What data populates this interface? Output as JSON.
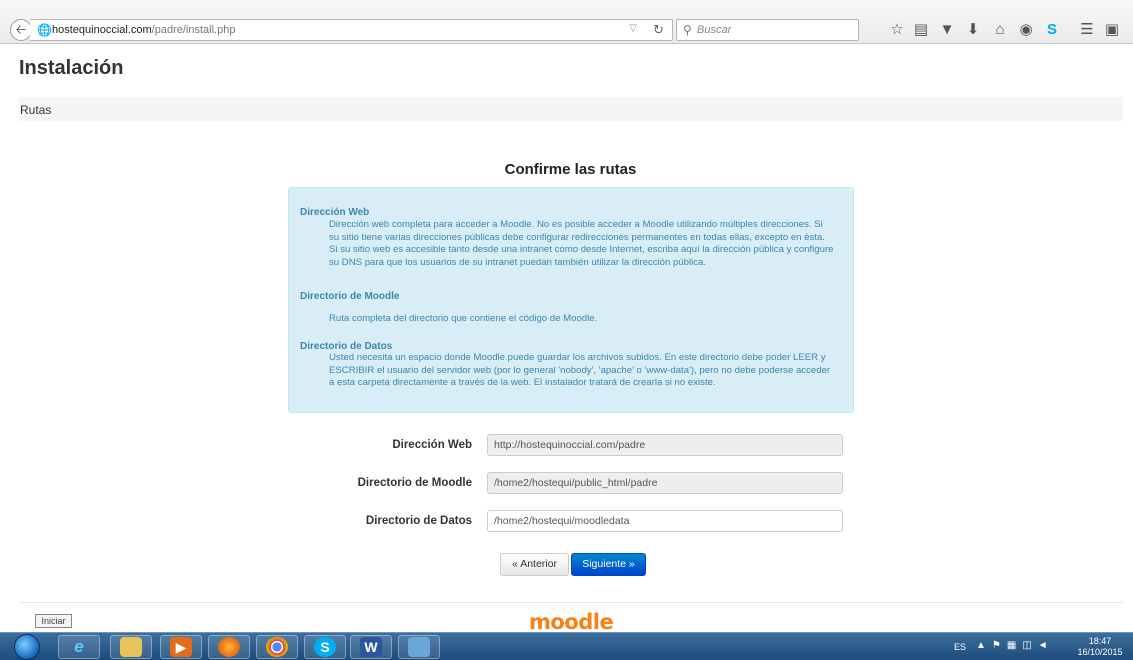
{
  "browser": {
    "url_domain": "hostequinoccial.com",
    "url_path": "/padre/install.php",
    "search_placeholder": "Buscar"
  },
  "page": {
    "title": "Instalación",
    "breadcrumb": "Rutas",
    "section_heading": "Confirme las rutas"
  },
  "info": {
    "web_heading": "Dirección Web",
    "web_text": "Dirección web completa para acceder a Moodle. No es posible acceder a Moodle utilizando múltiples direcciones. Si su sitio tiene varias direcciones públicas debe configurar redirecciones permanentes en todas ellas, excepto en ésta. Si su sitio web es accesible tanto desde una intranet como desde Internet, escriba aquí la dirección pública y configure su DNS para que los usuarios de su intranet puedan también utilizar la dirección pública.",
    "moodle_heading": "Directorio de Moodle",
    "moodle_text": "Ruta completa del directorio que contiene el código de Moodle.",
    "data_heading": "Directorio de Datos",
    "data_text": "Usted necesita un espacio donde Moodle puede guardar los archivos subidos. En este directorio debe poder LEER y ESCRIBIR el usuario del servidor web (por lo general 'nobody', 'apache' o 'www-data'), pero no debe poderse acceder a esta carpeta directamente a través de la web. El instalador tratará de crearla si no existe."
  },
  "form": {
    "wwwroot_label": "Dirección Web",
    "wwwroot_value": "http://hostequinoccial.com/padre",
    "dirroot_label": "Directorio de Moodle",
    "dirroot_value": "/home2/hostequi/public_html/padre",
    "dataroot_label": "Directorio de Datos",
    "dataroot_value": "/home2/hostequi/moodledata"
  },
  "buttons": {
    "previous": "« Anterior",
    "next": "Siguiente »"
  },
  "footer": {
    "iniciar": "Iniciar",
    "logo": "moodle"
  },
  "taskbar": {
    "language": "ES",
    "time": "18:47",
    "date": "16/10/2015"
  }
}
